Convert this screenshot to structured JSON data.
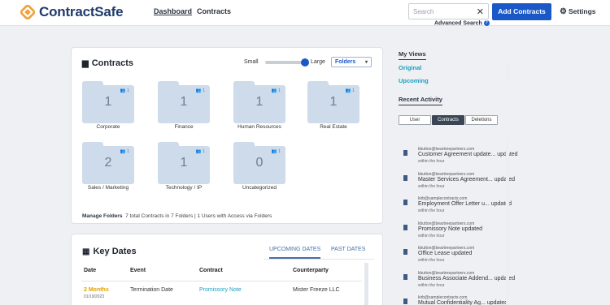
{
  "header": {
    "brand": "ContractSafe",
    "nav": [
      "Dashboard",
      "Contracts"
    ],
    "search_placeholder": "Search",
    "advanced_search": "Advanced Search",
    "add_button": "Add Contracts",
    "settings": "Settings"
  },
  "contracts": {
    "title": "Contracts",
    "size_small": "Small",
    "size_large": "Large",
    "size_level": 1.0,
    "view_select": "Folders",
    "folders": [
      {
        "name": "Corporate",
        "count": "1",
        "users": "1"
      },
      {
        "name": "Finance",
        "count": "1",
        "users": "1"
      },
      {
        "name": "Human Resources",
        "count": "1",
        "users": "1"
      },
      {
        "name": "Real Estate",
        "count": "1",
        "users": "1"
      },
      {
        "name": "Sales / Marketing",
        "count": "2",
        "users": "1"
      },
      {
        "name": "Technology / IP",
        "count": "1",
        "users": "1"
      },
      {
        "name": "Uncategorized",
        "count": "0",
        "users": "1"
      }
    ],
    "manage_label": "Manage Folders",
    "manage_info": "7 total Contracts in 7 Folders  |  1 Users with Access via Folders"
  },
  "key_dates": {
    "title": "Key Dates",
    "tabs": [
      "UPCOMING DATES",
      "PAST DATES"
    ],
    "columns": [
      "Date",
      "Event",
      "Contract",
      "Counterparty"
    ],
    "rows": [
      {
        "date": "2 Months",
        "date_sub": "01/19/2023",
        "event": "Termination Date",
        "contract": "Promissory Note",
        "counterparty": "Mister Freeze LLC"
      }
    ]
  },
  "sidebar": {
    "my_views_title": "My Views",
    "views": [
      "Original",
      "Upcoming"
    ],
    "recent_activity_title": "Recent Activity",
    "filters": [
      "User",
      "Contracts",
      "Deletions"
    ],
    "activity": [
      {
        "user": "kbutton@beartreepartners.com",
        "message": "Customer Agreement update... updated",
        "time": "within the hour"
      },
      {
        "user": "kbutton@beartreepartners.com",
        "message": "Master Services Agreement... updated",
        "time": "within the hour"
      },
      {
        "user": "kirb@samplecontracts.com",
        "message": "Employment Offer Letter u... updated",
        "time": "within the hour"
      },
      {
        "user": "kbutton@beartreepartners.com",
        "message": "Promissory Note updated",
        "time": "within the hour"
      },
      {
        "user": "kbutton@beartreepartners.com",
        "message": "Office Lease updated",
        "time": "within the hour"
      },
      {
        "user": "kbutton@beartreepartners.com",
        "message": "Business Associate Addend... updated",
        "time": "within the hour"
      },
      {
        "user": "kirb@samplecontracts.com",
        "message": "Mutual Confidentiality Ag... updated",
        "time": "within the hour"
      }
    ]
  },
  "colors": {
    "accent": "#1b58c7",
    "brand_orange": "#f0a23a",
    "view_link": "#1b9fbf",
    "date_highlight": "#e0a100"
  }
}
